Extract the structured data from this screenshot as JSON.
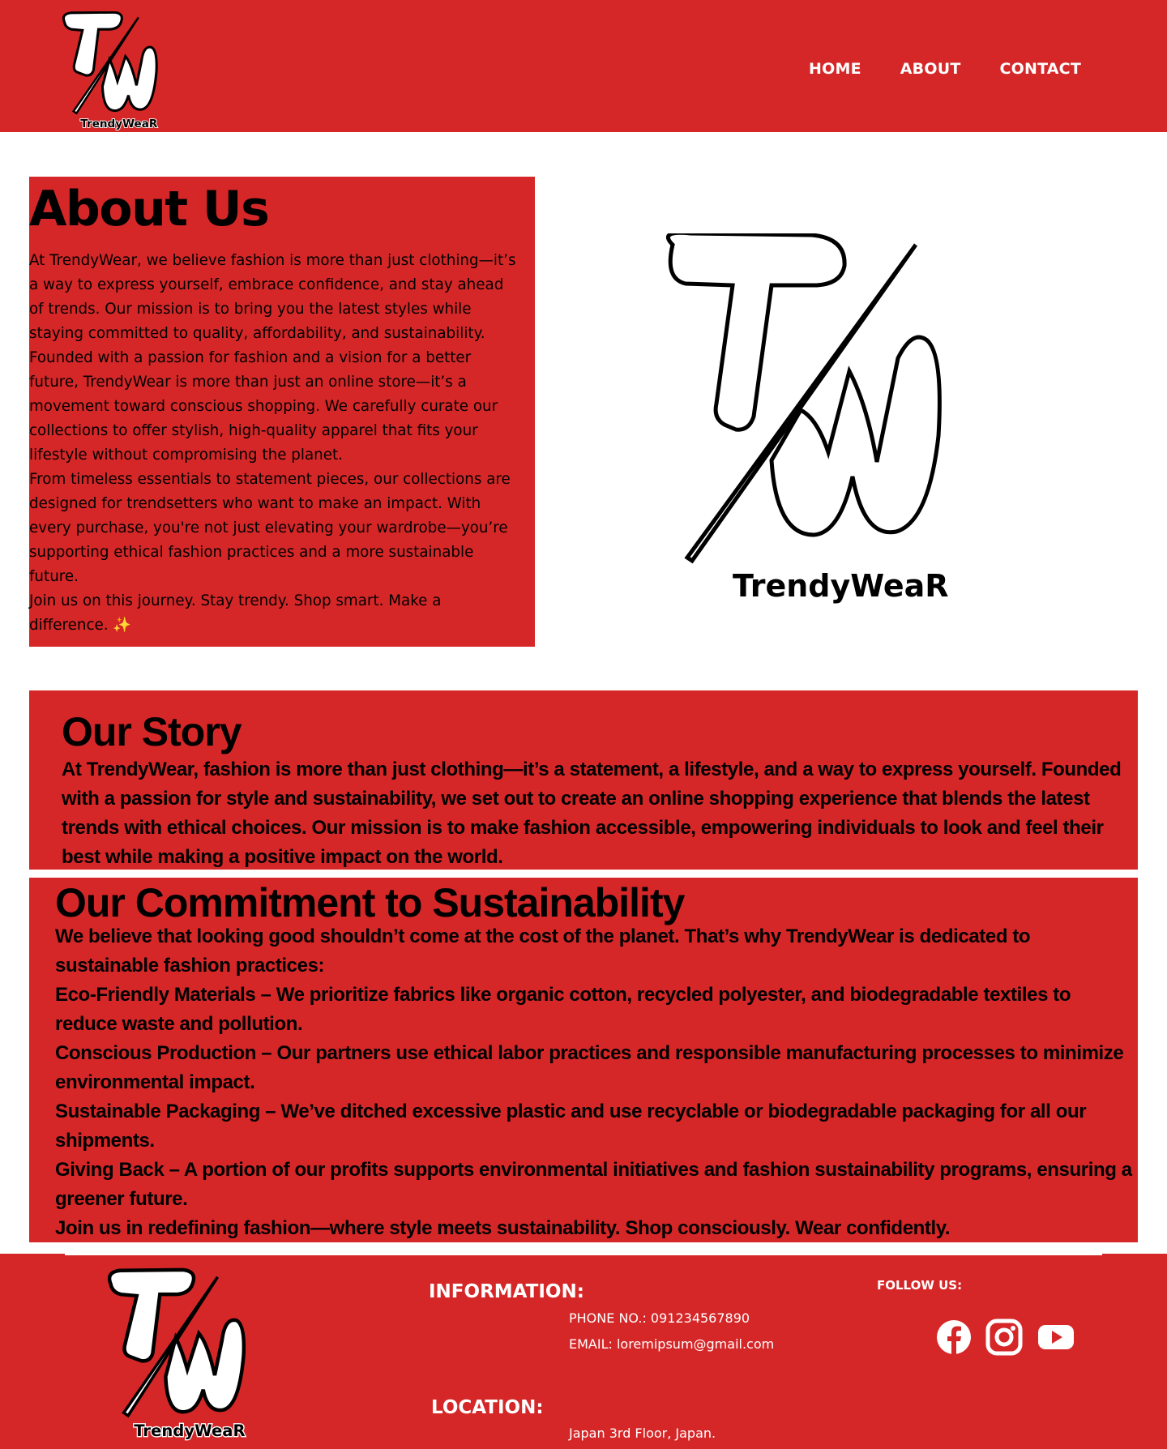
{
  "brand": {
    "logo_text": "TrendyWeaR"
  },
  "nav": {
    "home": "HOME",
    "about": "ABOUT",
    "contact": "CONTACT"
  },
  "about": {
    "title": "About Us",
    "body": "At TrendyWear, we believe fashion is more than just clothing—it’s\na way to express yourself, embrace confidence, and stay ahead\nof trends. Our mission is to bring you the latest styles while\nstaying committed to quality, affordability, and sustainability.\nFounded with a passion for fashion and a vision for a better\nfuture, TrendyWear is more than just an online store—it’s a\nmovement toward conscious shopping. We carefully curate our\ncollections to offer stylish, high-quality apparel that fits your\nlifestyle without compromising the planet.\nFrom timeless essentials to statement pieces, our collections are\ndesigned for trendsetters who want to make an impact. With\nevery purchase, you're not just elevating your wardrobe—you’re\nsupporting ethical fashion practices and a more sustainable\nfuture.\nJoin us on this journey. Stay trendy. Shop smart. Make a\ndifference. ✨"
  },
  "story": {
    "title": "Our Story",
    "body": "At TrendyWear, fashion is more than just clothing—it’s a statement, a lifestyle, and a way to express yourself. Founded with a passion for style and sustainability, we set out to create an online shopping experience that blends the latest trends with ethical choices. Our mission is to make fashion accessible, empowering individuals to look and feel their best while making a positive impact on the world."
  },
  "commitment": {
    "title": "Our Commitment to Sustainability",
    "intro": "We believe that looking good shouldn’t come at the cost of the planet. That’s why TrendyWear is dedicated to sustainable fashion practices:",
    "items": [
      "Eco-Friendly Materials – We prioritize fabrics like organic cotton, recycled polyester, and biodegradable textiles to reduce waste and pollution.",
      "Conscious Production – Our partners use ethical labor practices and responsible manufacturing processes to minimize environmental impact.",
      "Sustainable Packaging – We’ve ditched excessive plastic and use recyclable or biodegradable packaging for all our shipments.",
      "Giving Back – A portion of our profits supports environmental initiatives and fashion sustainability programs, ensuring  a greener future."
    ],
    "closing": "Join us in redefining fashion—where style meets sustainability. Shop consciously. Wear confidently."
  },
  "footer": {
    "info_title": "INFORMATION:",
    "phone": "PHONE NO.: 091234567890",
    "email": "EMAIL: loremipsum@gmail.com",
    "location_title": "LOCATION:",
    "location": "Japan 3rd Floor, Japan.",
    "follow": "FOLLOW US:",
    "social_icons": [
      "facebook-icon",
      "instagram-icon",
      "youtube-icon"
    ]
  },
  "colors": {
    "brand_red": "#d62728",
    "white": "#ffffff",
    "black": "#000000"
  }
}
